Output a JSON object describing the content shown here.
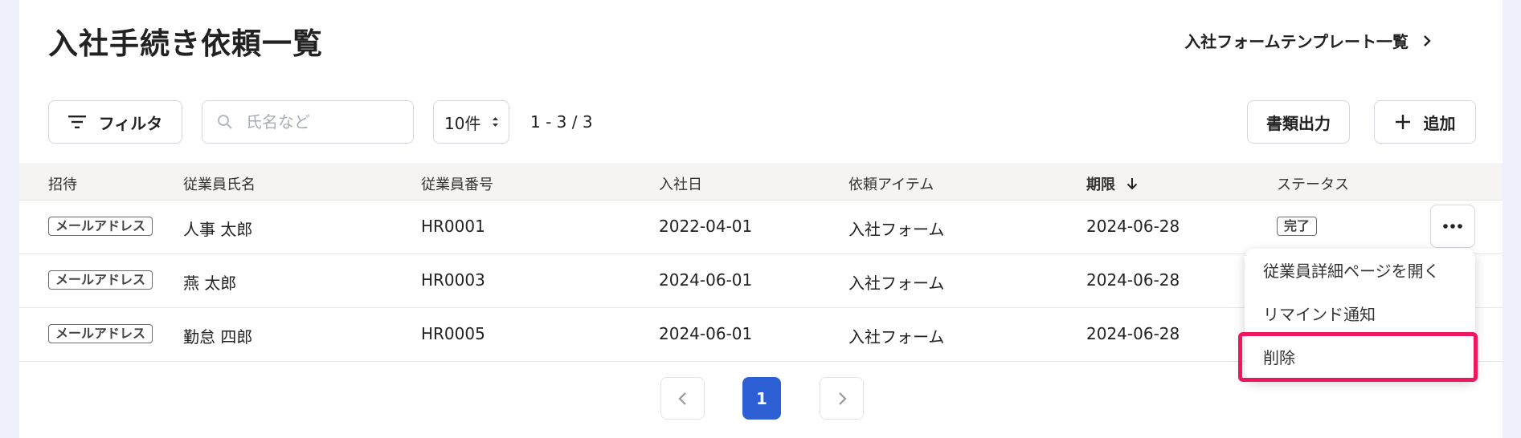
{
  "page": {
    "title": "入社手続き依頼一覧",
    "template_link": "入社フォームテンプレート一覧"
  },
  "toolbar": {
    "filter_label": "フィルタ",
    "search_placeholder": "氏名など",
    "search_value": "",
    "per_page": "10件",
    "range": "1 - 3 / 3",
    "export_label": "書類出力",
    "add_label": "追加"
  },
  "table": {
    "headers": [
      "招待",
      "従業員氏名",
      "従業員番号",
      "入社日",
      "依頼アイテム",
      "期限",
      "ステータス"
    ],
    "sorted_column": "期限",
    "rows": [
      {
        "invite": "メールアドレス",
        "name": "人事 太郎",
        "number": "HR0001",
        "join_date": "2022-04-01",
        "item": "入社フォーム",
        "deadline": "2024-06-28",
        "status": "完了"
      },
      {
        "invite": "メールアドレス",
        "name": "燕 太郎",
        "number": "HR0003",
        "join_date": "2024-06-01",
        "item": "入社フォーム",
        "deadline": "2024-06-28",
        "status": ""
      },
      {
        "invite": "メールアドレス",
        "name": "勤怠 四郎",
        "number": "HR0005",
        "join_date": "2024-06-01",
        "item": "入社フォーム",
        "deadline": "2024-06-28",
        "status": ""
      }
    ]
  },
  "row_menu": {
    "items": [
      "従業員詳細ページを開く",
      "リマインド通知",
      "削除"
    ],
    "highlighted": "削除"
  },
  "pagination": {
    "current": "1"
  },
  "colors": {
    "accent": "#2b5fd3",
    "highlight": "#ee1660",
    "background": "#eef1fb"
  }
}
